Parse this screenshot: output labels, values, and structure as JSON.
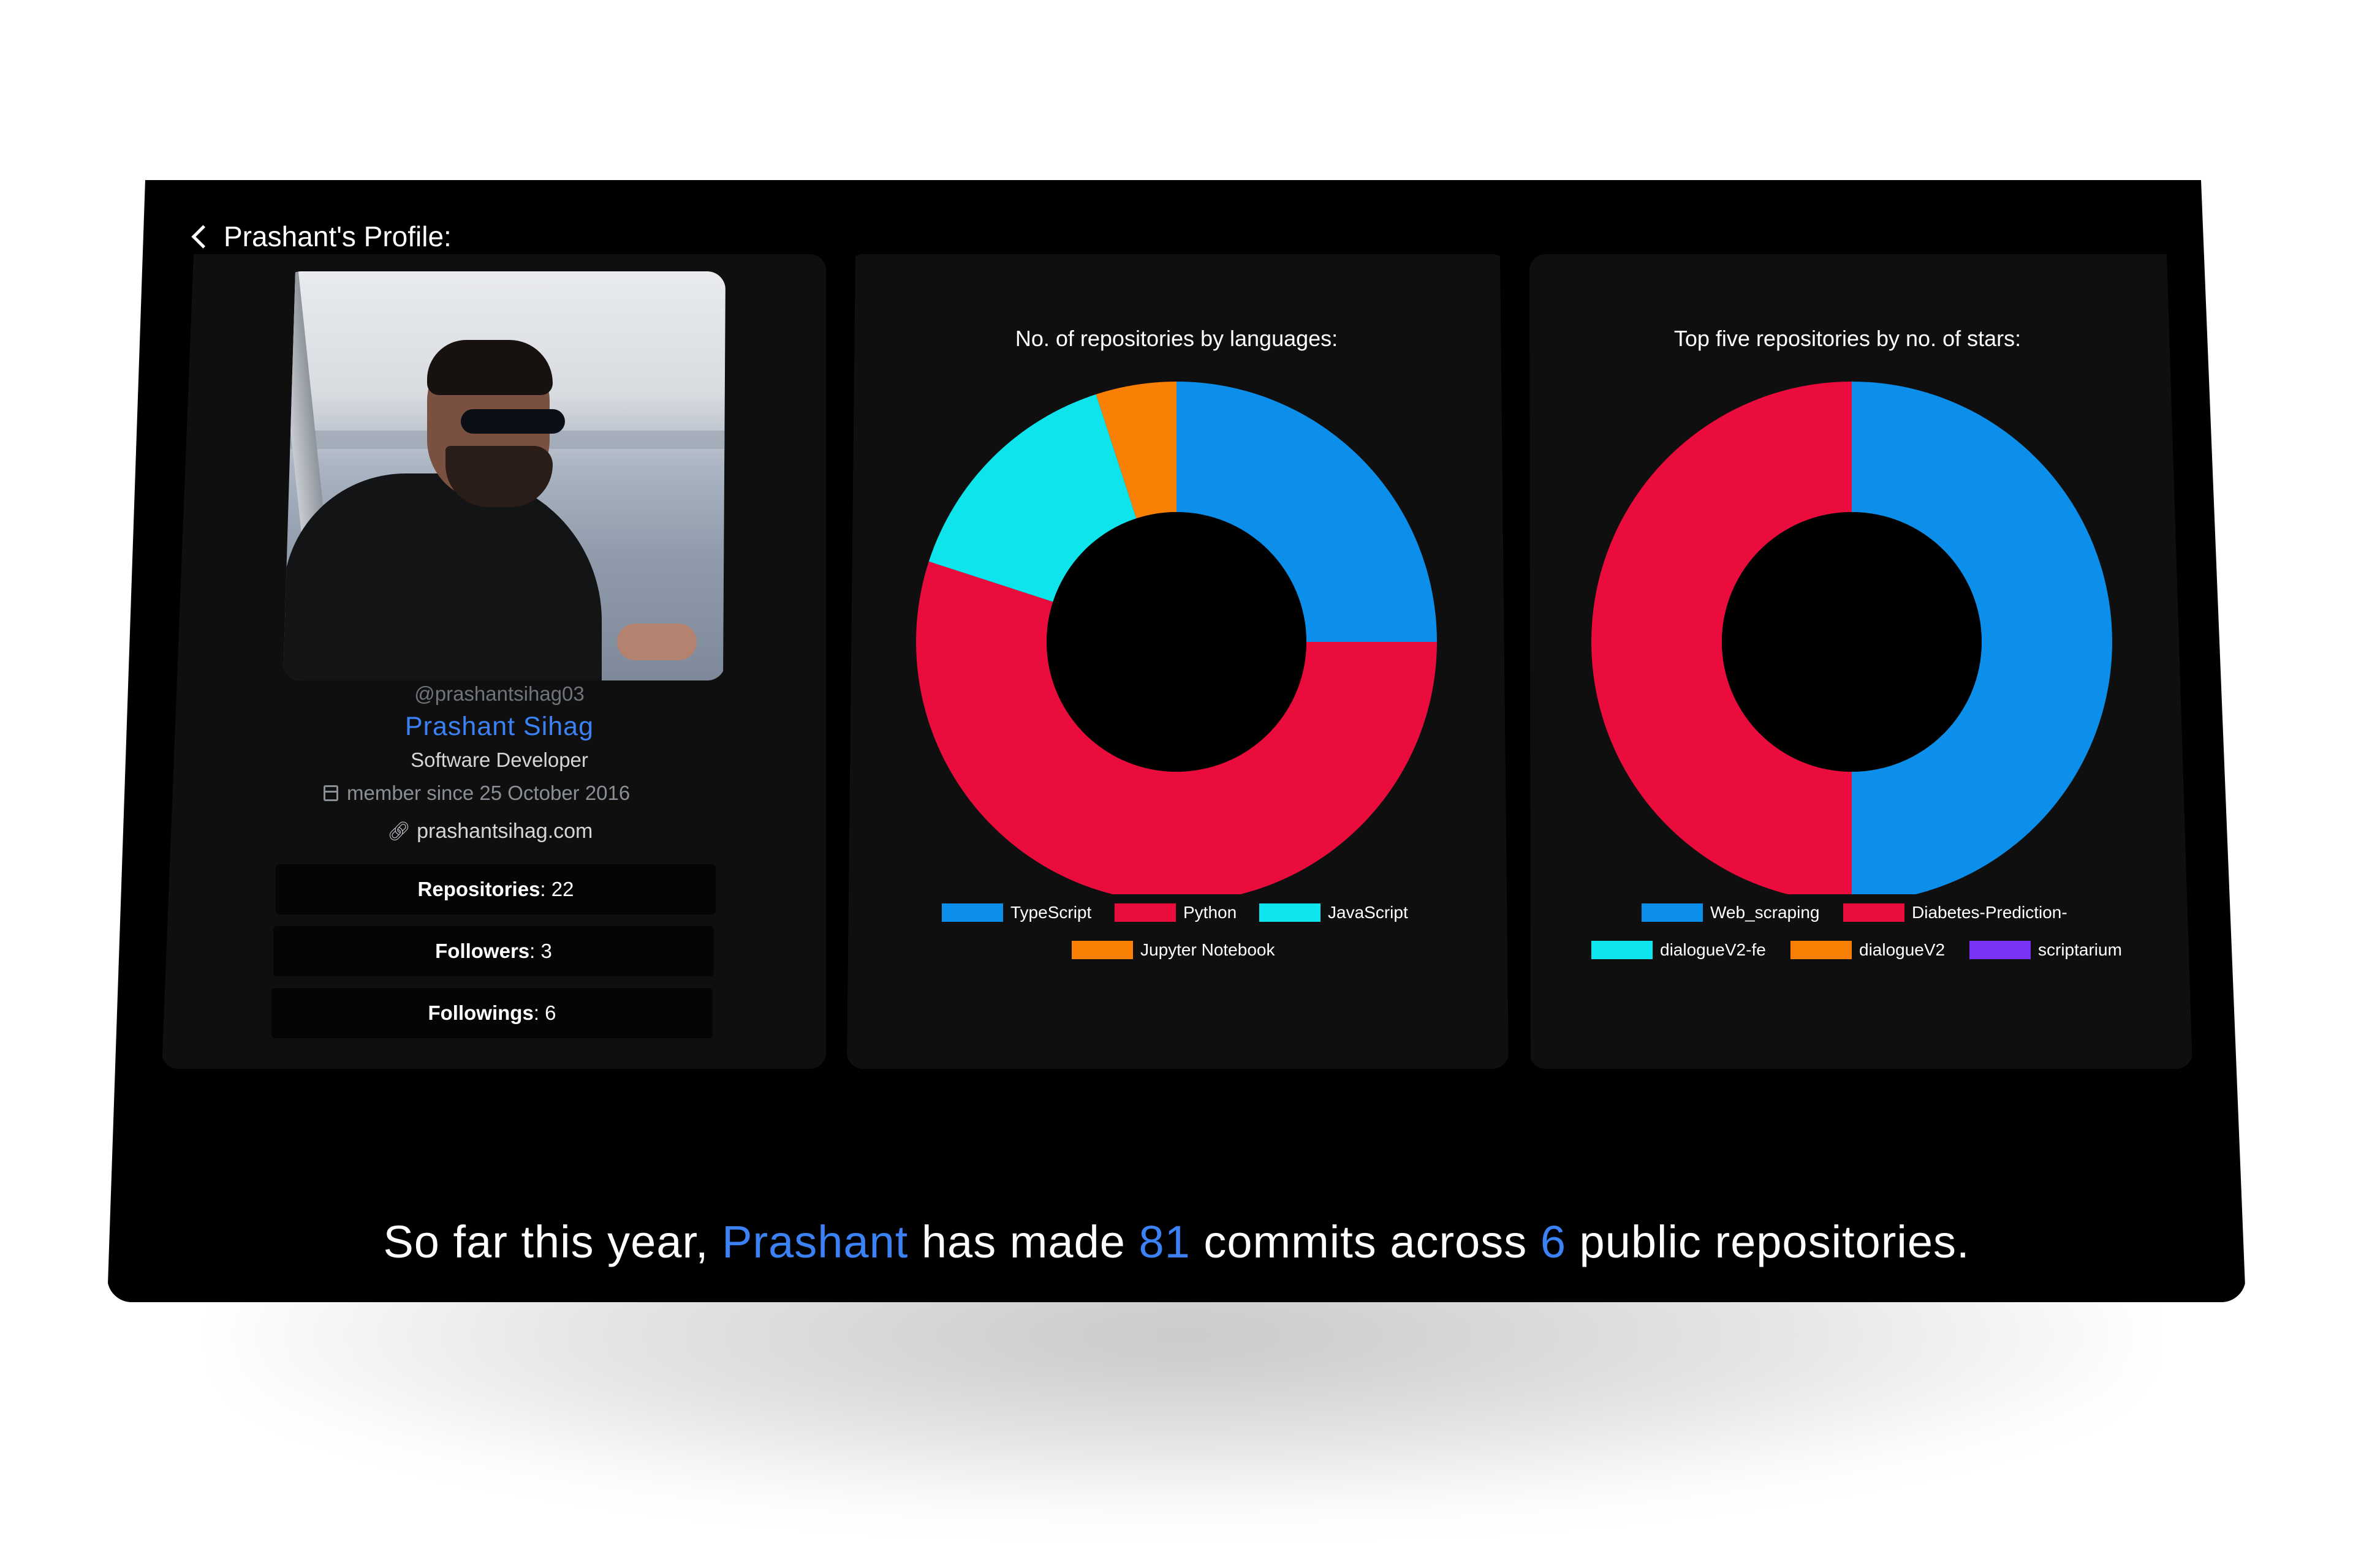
{
  "header": {
    "back_label": "Prashant's Profile:"
  },
  "profile": {
    "handle": "@prashantsihag03",
    "name": "Prashant Sihag",
    "role": "Software Developer",
    "member_since": "member since 25 October 2016",
    "website": "prashantsihag.com",
    "stats": [
      {
        "label": "Repositories",
        "value": ": 22"
      },
      {
        "label": "Followers",
        "value": ": 3"
      },
      {
        "label": "Followings",
        "value": ": 6"
      }
    ]
  },
  "chart_data": [
    {
      "type": "pie",
      "title": "No. of repositories by languages:",
      "labels": [
        "TypeScript",
        "Python",
        "JavaScript",
        "Jupyter Notebook"
      ],
      "values": [
        25,
        55,
        15,
        5
      ],
      "colors": [
        "#0c8fea",
        "#ea0c3c",
        "#0de4ec",
        "#fa8005"
      ]
    },
    {
      "type": "pie",
      "title": "Top five repositories by no. of stars:",
      "labels": [
        "Web_scraping",
        "Diabetes-Prediction-",
        "dialogueV2-fe",
        "dialogueV2",
        "scriptarium"
      ],
      "values": [
        1,
        1,
        0,
        0,
        0
      ],
      "colors": [
        "#0c8fea",
        "#ea0c3c",
        "#0de4ec",
        "#fa8005",
        "#7a32f5"
      ]
    }
  ],
  "summary": {
    "part1": "So far this year, ",
    "name": "Prashant",
    "part2": " has made ",
    "commits": "81",
    "part3": " commits across ",
    "repos": "6",
    "part4": " public repositories."
  },
  "icons": {
    "back": "chevron-left-icon",
    "calendar": "calendar-icon",
    "link": "link-icon"
  }
}
